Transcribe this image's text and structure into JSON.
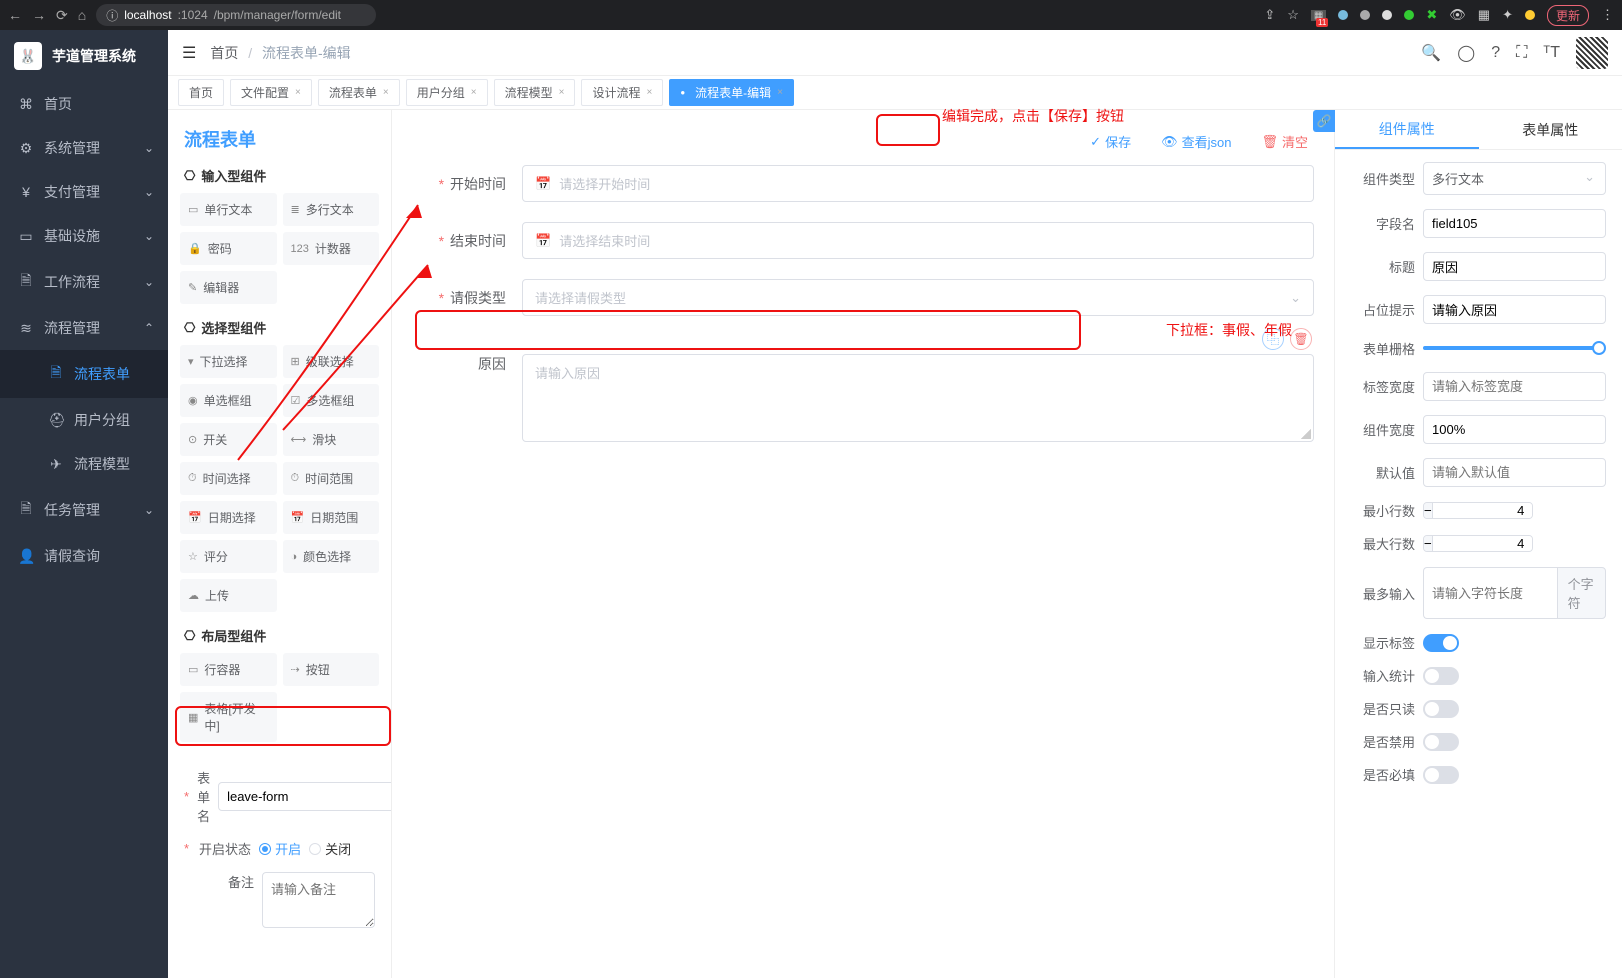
{
  "browser": {
    "url_host": "localhost",
    "url_port": ":1024",
    "url_path": "/bpm/manager/form/edit",
    "update_label": "更新",
    "badge": "11"
  },
  "brand": "芋道管理系统",
  "sidebar": {
    "items": [
      {
        "icon": "⌘",
        "label": "首页"
      },
      {
        "icon": "⚙",
        "label": "系统管理",
        "children": true
      },
      {
        "icon": "¥",
        "label": "支付管理",
        "children": true
      },
      {
        "icon": "▭",
        "label": "基础设施",
        "children": true
      },
      {
        "icon": "🗎",
        "label": "工作流程",
        "children": true
      },
      {
        "icon": "≋",
        "label": "流程管理",
        "children": true,
        "expanded": true,
        "subs": [
          {
            "icon": "🗎",
            "label": "流程表单",
            "active": true
          },
          {
            "icon": "⛑",
            "label": "用户分组"
          },
          {
            "icon": "✈",
            "label": "流程模型"
          }
        ]
      },
      {
        "icon": "🗎",
        "label": "任务管理",
        "children": true
      },
      {
        "icon": "👤",
        "label": "请假查询"
      }
    ]
  },
  "breadcrumb": {
    "home": "首页",
    "current": "流程表单-编辑"
  },
  "tabs": [
    "首页",
    "文件配置",
    "流程表单",
    "用户分组",
    "流程模型",
    "设计流程",
    "流程表单-编辑"
  ],
  "active_tab": 6,
  "page_title": "流程表单",
  "actions": {
    "save": "保存",
    "view_json": "查看json",
    "clear": "清空"
  },
  "groups": {
    "input": {
      "title": "输入型组件",
      "items": [
        "单行文本",
        "多行文本",
        "密码",
        "计数器",
        "编辑器"
      ]
    },
    "select": {
      "title": "选择型组件",
      "items": [
        "下拉选择",
        "级联选择",
        "单选框组",
        "多选框组",
        "开关",
        "滑块",
        "时间选择",
        "时间范围",
        "日期选择",
        "日期范围",
        "评分",
        "颜色选择",
        "上传"
      ]
    },
    "layout": {
      "title": "布局型组件",
      "items": [
        "行容器",
        "按钮",
        "表格[开发中]"
      ]
    }
  },
  "comp_icons": [
    "▭",
    "≣",
    "🔒",
    "123",
    "✎",
    "▾",
    "⊞",
    "◉",
    "☑",
    "⊙",
    "⟷",
    "⏱",
    "⏱",
    "📅",
    "📅",
    "☆",
    "◑",
    "☁",
    "▭",
    "⇢",
    "▦"
  ],
  "meta": {
    "form_name_label": "表单名",
    "form_name_value": "leave-form",
    "status_label": "开启状态",
    "status_on": "开启",
    "status_off": "关闭",
    "remark_label": "备注",
    "remark_placeholder": "请输入备注"
  },
  "canvas": {
    "fields": [
      {
        "label": "开始时间",
        "required": true,
        "placeholder": "请选择开始时间",
        "type": "date"
      },
      {
        "label": "结束时间",
        "required": true,
        "placeholder": "请选择结束时间",
        "type": "date"
      },
      {
        "label": "请假类型",
        "required": true,
        "placeholder": "请选择请假类型",
        "type": "select"
      },
      {
        "label": "原因",
        "required": false,
        "placeholder": "请输入原因",
        "type": "textarea",
        "selected": true
      }
    ]
  },
  "annotations": {
    "top_text": "编辑完成，点击【保存】按钮",
    "select_hint": "下拉框：事假、年假"
  },
  "right_panel": {
    "tabs": [
      "组件属性",
      "表单属性"
    ],
    "active": 0,
    "props": {
      "component_type_label": "组件类型",
      "component_type_value": "多行文本",
      "field_name_label": "字段名",
      "field_name_value": "field105",
      "title_label": "标题",
      "title_value": "原因",
      "placeholder_label": "占位提示",
      "placeholder_value": "请输入原因",
      "grid_label": "表单栅格",
      "label_width_label": "标签宽度",
      "label_width_placeholder": "请输入标签宽度",
      "comp_width_label": "组件宽度",
      "comp_width_value": "100%",
      "default_label": "默认值",
      "default_placeholder": "请输入默认值",
      "min_rows_label": "最小行数",
      "min_rows_value": "4",
      "max_rows_label": "最大行数",
      "max_rows_value": "4",
      "max_input_label": "最多输入",
      "max_input_placeholder": "请输入字符长度",
      "max_input_addon": "个字符",
      "show_label_label": "显示标签",
      "input_stat_label": "输入统计",
      "readonly_label": "是否只读",
      "disabled_label": "是否禁用",
      "required_label": "是否必填"
    }
  }
}
